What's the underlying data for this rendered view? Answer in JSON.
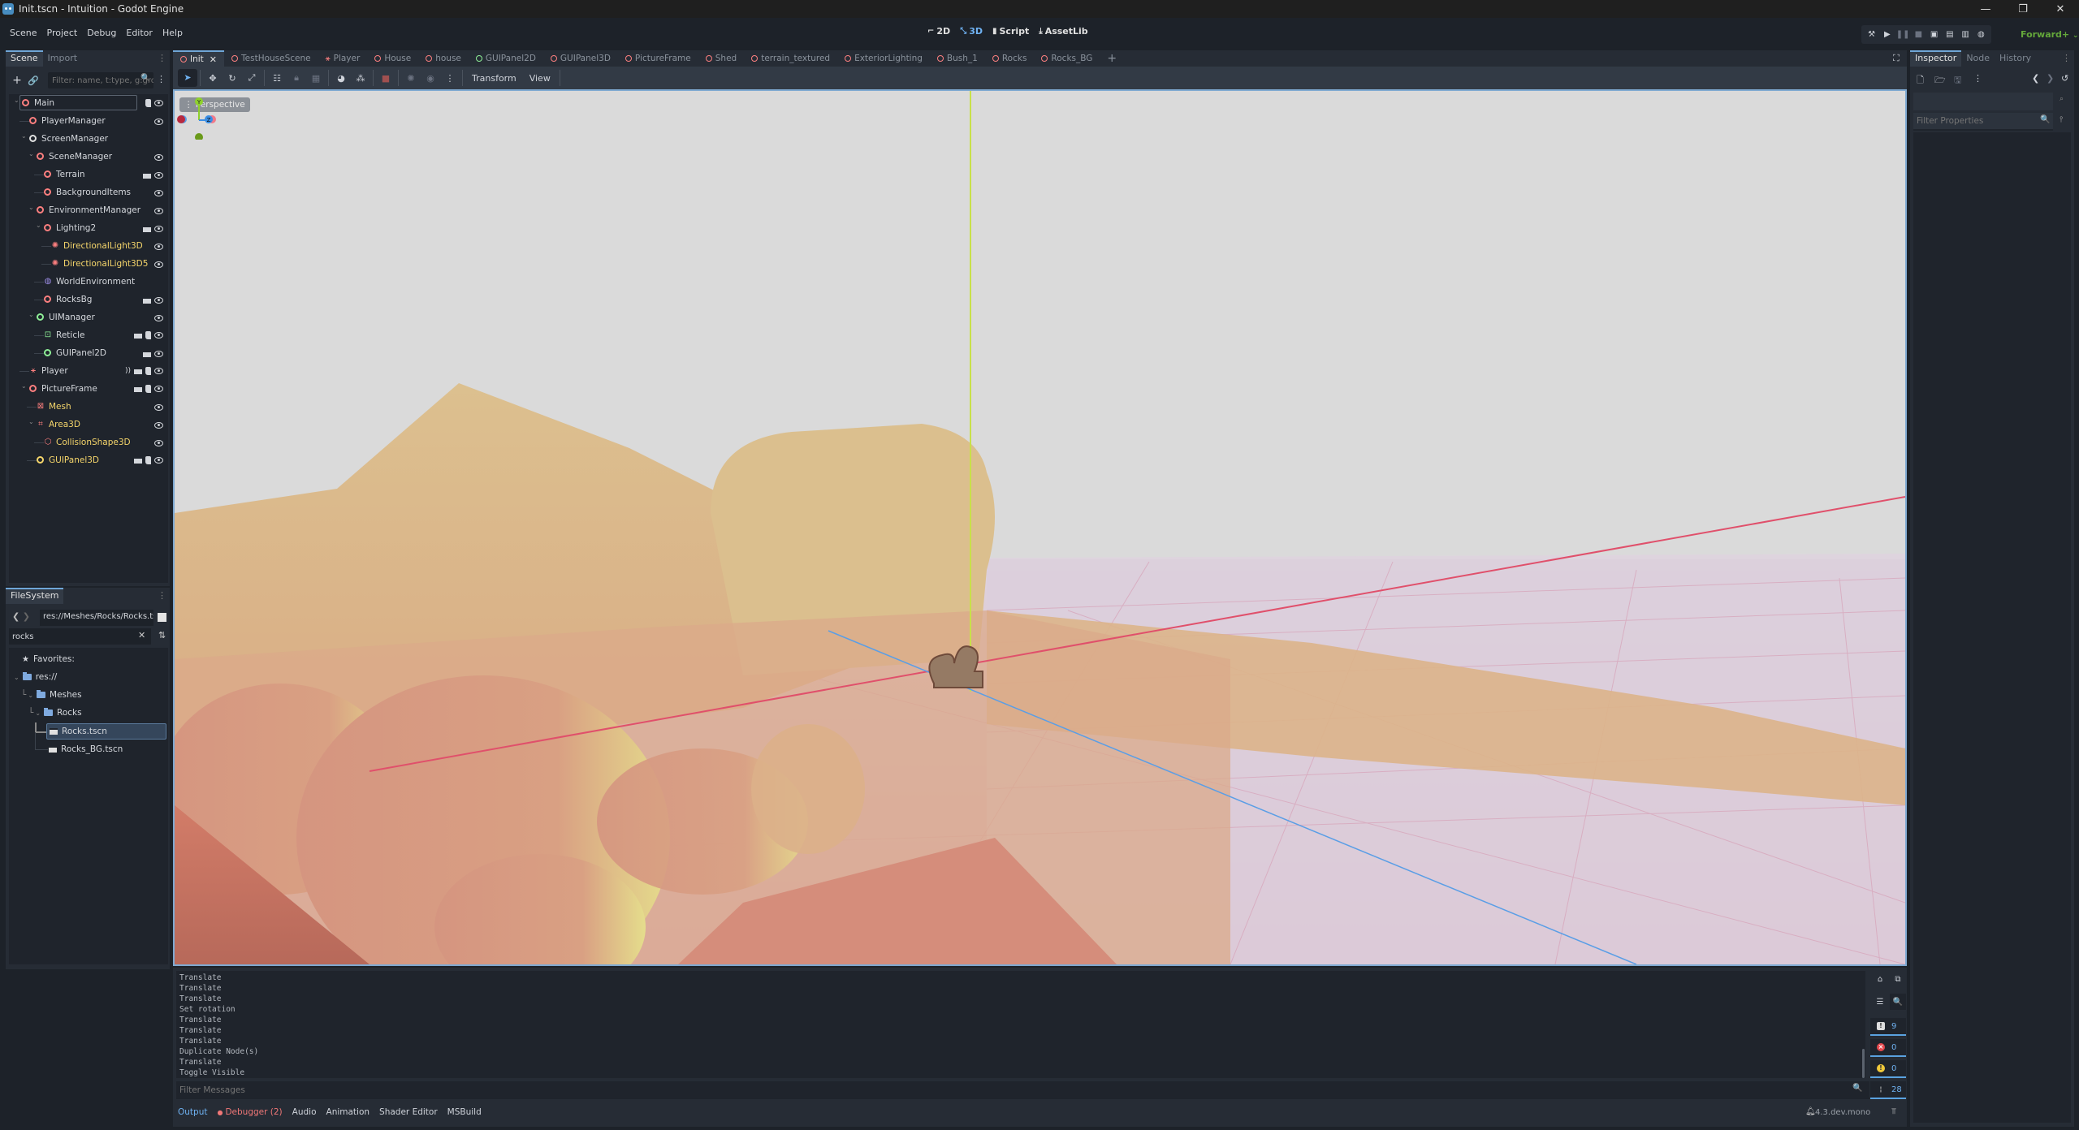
{
  "window": {
    "title": "Init.tscn - Intuition - Godot Engine",
    "controls": [
      "minimize",
      "restore",
      "close"
    ]
  },
  "menubar": {
    "items": [
      "Scene",
      "Project",
      "Debug",
      "Editor",
      "Help"
    ],
    "workspaces": [
      {
        "label": "2D",
        "icon": "2d-icon",
        "active": false
      },
      {
        "label": "3D",
        "icon": "3d-icon",
        "active": true
      },
      {
        "label": "Script",
        "icon": "script-icon",
        "active": false
      },
      {
        "label": "AssetLib",
        "icon": "assetlib-icon",
        "active": false
      }
    ],
    "run_buttons": [
      "build",
      "play",
      "pause",
      "stop",
      "remote-debug",
      "play-scene",
      "play-custom-scene",
      "movie-maker"
    ],
    "renderer": "Forward+"
  },
  "scene_panel": {
    "tabs": [
      "Scene",
      "Import"
    ],
    "active_tab": "Scene",
    "filter_placeholder": "Filter: name, t:type, g:group",
    "nodes": [
      {
        "name": "Main",
        "depth": 0,
        "icon": "node3d",
        "color": "red",
        "expanded": true,
        "selected_outline": true,
        "badges": [
          "script"
        ],
        "visible": true
      },
      {
        "name": "PlayerManager",
        "depth": 1,
        "icon": "node3d",
        "color": "red",
        "badges": [],
        "visible": true
      },
      {
        "name": "ScreenManager",
        "depth": 1,
        "icon": "node",
        "color": "white",
        "expanded": true,
        "badges": [],
        "visible": null
      },
      {
        "name": "SceneManager",
        "depth": 2,
        "icon": "node3d",
        "color": "red",
        "expanded": true,
        "badges": [],
        "visible": true
      },
      {
        "name": "Terrain",
        "depth": 3,
        "icon": "node3d",
        "color": "red",
        "badges": [
          "scene"
        ],
        "visible": true
      },
      {
        "name": "BackgroundItems",
        "depth": 3,
        "icon": "node3d",
        "color": "red",
        "badges": [],
        "visible": true
      },
      {
        "name": "EnvironmentManager",
        "depth": 2,
        "icon": "node3d",
        "color": "red",
        "expanded": true,
        "badges": [],
        "visible": true
      },
      {
        "name": "Lighting2",
        "depth": 3,
        "icon": "node3d",
        "color": "red",
        "expanded": true,
        "badges": [
          "scene"
        ],
        "visible": true
      },
      {
        "name": "DirectionalLight3D",
        "depth": 4,
        "icon": "light",
        "color": "yellow",
        "badges": [],
        "visible": true
      },
      {
        "name": "DirectionalLight3D5",
        "depth": 4,
        "icon": "light",
        "color": "yellow",
        "badges": [],
        "visible": true
      },
      {
        "name": "WorldEnvironment",
        "depth": 3,
        "icon": "world-environment",
        "color": "white",
        "badges": [],
        "visible": null
      },
      {
        "name": "RocksBg",
        "depth": 3,
        "icon": "node3d",
        "color": "red",
        "badges": [
          "scene"
        ],
        "visible": true
      },
      {
        "name": "UIManager",
        "depth": 2,
        "icon": "control",
        "color": "green",
        "expanded": true,
        "badges": [],
        "visible": true
      },
      {
        "name": "Reticle",
        "depth": 3,
        "icon": "reticle",
        "color": "green",
        "badges": [
          "scene",
          "script"
        ],
        "visible": true
      },
      {
        "name": "GUIPanel2D",
        "depth": 3,
        "icon": "control",
        "color": "green",
        "badges": [
          "scene"
        ],
        "visible": true
      },
      {
        "name": "Player",
        "depth": 1,
        "icon": "character",
        "color": "red",
        "badges": [
          "signal",
          "scene",
          "script"
        ],
        "visible": true
      },
      {
        "name": "PictureFrame",
        "depth": 1,
        "icon": "node3d",
        "color": "red",
        "expanded": true,
        "badges": [
          "scene",
          "script"
        ],
        "visible": true
      },
      {
        "name": "Mesh",
        "depth": 2,
        "icon": "mesh",
        "color": "yellow",
        "badges": [],
        "visible": true
      },
      {
        "name": "Area3D",
        "depth": 2,
        "icon": "area3d",
        "color": "yellow",
        "expanded": true,
        "badges": [],
        "visible": true
      },
      {
        "name": "CollisionShape3D",
        "depth": 3,
        "icon": "collision-shape",
        "color": "yellow",
        "badges": [],
        "visible": true
      },
      {
        "name": "GUIPanel3D",
        "depth": 2,
        "icon": "node3d",
        "color": "yellow",
        "badges": [
          "scene",
          "script"
        ],
        "visible": true
      }
    ]
  },
  "filesystem": {
    "tab": "FileSystem",
    "path": "res://Meshes/Rocks/Rocks.tscn",
    "search_value": "rocks",
    "items": [
      {
        "label": "Favorites:",
        "type": "favorites",
        "depth": 0
      },
      {
        "label": "res://",
        "type": "folder",
        "depth": 0
      },
      {
        "label": "Meshes",
        "type": "folder",
        "depth": 1
      },
      {
        "label": "Rocks",
        "type": "folder",
        "depth": 2
      },
      {
        "label": "Rocks.tscn",
        "type": "scene",
        "depth": 3,
        "selected": true
      },
      {
        "label": "Rocks_BG.tscn",
        "type": "scene",
        "depth": 3
      }
    ]
  },
  "editor_tabs": [
    {
      "label": "Init",
      "active": true,
      "closable": true,
      "icon": "node3d"
    },
    {
      "label": "TestHouseScene",
      "icon": "node3d"
    },
    {
      "label": "Player",
      "icon": "character"
    },
    {
      "label": "House",
      "icon": "node3d"
    },
    {
      "label": "house",
      "icon": "node3d"
    },
    {
      "label": "GUIPanel2D",
      "icon": "control"
    },
    {
      "label": "GUIPanel3D",
      "icon": "node3d"
    },
    {
      "label": "PictureFrame",
      "icon": "node3d"
    },
    {
      "label": "Shed",
      "icon": "node3d"
    },
    {
      "label": "terrain_textured",
      "icon": "node3d"
    },
    {
      "label": "ExteriorLighting",
      "icon": "node3d"
    },
    {
      "label": "Bush_1",
      "icon": "node3d"
    },
    {
      "label": "Rocks",
      "icon": "node3d"
    },
    {
      "label": "Rocks_BG",
      "icon": "node3d"
    }
  ],
  "viewport_toolbar": {
    "tools": [
      "select",
      "move",
      "rotate",
      "scale",
      "list-select",
      "lock",
      "group",
      "local-space",
      "snap",
      "camera-preview",
      "sun-preview",
      "environment-preview",
      "more"
    ],
    "menus": [
      "Transform",
      "View"
    ]
  },
  "viewport": {
    "view_label": "Perspective",
    "gizmo_axes": [
      "Y",
      "Z"
    ],
    "colors": {
      "sky": "#dadada",
      "ground_far": "#ddd0dc",
      "rock_sand": "#dbbd8e",
      "rock_pink": "#d9957f",
      "rock_red": "#c3705f",
      "rock_highlight": "#e5e08c",
      "x_axis": "#e0506b",
      "y_axis": "#c8e04a",
      "z_axis": "#5a9ee6"
    }
  },
  "output": {
    "lines": [
      "Translate",
      "Translate",
      "Translate",
      "Set rotation",
      "Translate",
      "Translate",
      "Translate",
      "Duplicate Node(s)",
      "Translate",
      "Toggle Visible"
    ],
    "filter_placeholder": "Filter Messages",
    "counters": {
      "messages": "9",
      "errors": "0",
      "warnings": "0",
      "editor": "28"
    }
  },
  "bottom_tabs": [
    {
      "label": "Output",
      "active": true
    },
    {
      "label": "Debugger (2)",
      "error": true
    },
    {
      "label": "Audio"
    },
    {
      "label": "Animation"
    },
    {
      "label": "Shader Editor"
    },
    {
      "label": "MSBuild"
    }
  ],
  "version": "4.3.dev.mono",
  "inspector": {
    "tabs": [
      "Inspector",
      "Node",
      "History"
    ],
    "active_tab": "Inspector",
    "filter_placeholder": "Filter Properties"
  }
}
